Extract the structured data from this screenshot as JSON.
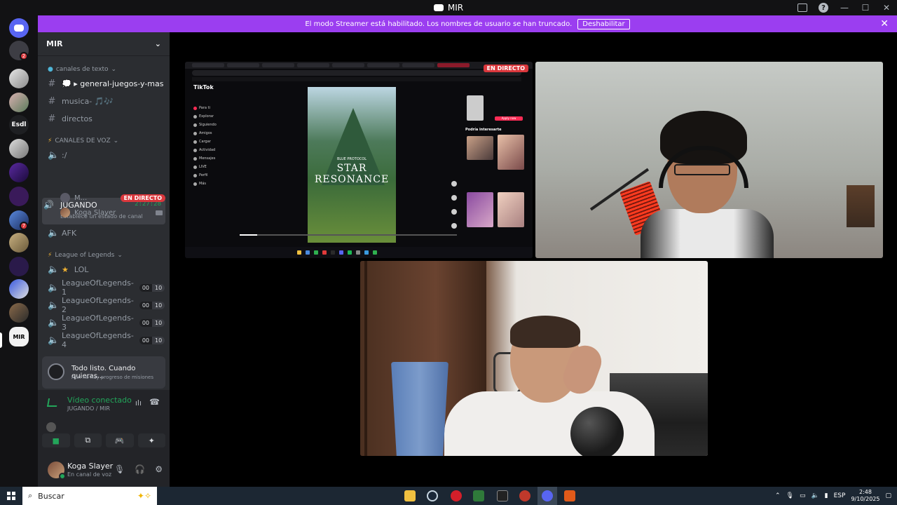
{
  "window": {
    "title": "MIR"
  },
  "streamer_banner": {
    "message": "El modo Streamer está habilitado. Los nombres de usuario se han truncado.",
    "disable_label": "Deshabilitar"
  },
  "servers": [
    {
      "name": "Esdl"
    }
  ],
  "guild": {
    "name": "MIR",
    "categories": {
      "text": "canales de texto",
      "voice": "CANALES DE VOZ",
      "lol": "League of Legends"
    },
    "text_channels": [
      {
        "name": "💭 ▸ general-juegos-y-mas"
      },
      {
        "name": "musica- 🎵🎶"
      },
      {
        "name": "directos"
      }
    ],
    "voice_channels": {
      "first": ":/",
      "jugando": {
        "name": "JUGANDO",
        "time": "2:27:28",
        "status": "Establece un estado de canal"
      },
      "users": [
        {
          "name": "M...",
          "badge": "EN DIRECTO"
        },
        {
          "name": "Koga Slayer"
        }
      ],
      "afk": "AFK",
      "lol": "LOL",
      "lol_channels": [
        {
          "name": "LeagueOfLegends-1",
          "count": "00",
          "limit": "10"
        },
        {
          "name": "LeagueOfLegends-2",
          "count": "00",
          "limit": "10"
        },
        {
          "name": "LeagueOfLegends-3",
          "count": "00",
          "limit": "10"
        },
        {
          "name": "LeagueOfLegends-4",
          "count": "00",
          "limit": "10"
        }
      ]
    }
  },
  "quest": {
    "title": "Todo listo. Cuando quieras...",
    "subtitle": "Aún no hay progreso de misiones"
  },
  "voice_status": {
    "title": "Vídeo conectado",
    "subtitle": "JUGANDO / MIR"
  },
  "user": {
    "name": "Koga Slayer",
    "status": "En canal de voz"
  },
  "stream": {
    "live_label": "EN DIRECTO",
    "tiktok": {
      "brand": "TikTok",
      "nav": [
        "Para ti",
        "Explorar",
        "Siguiendo",
        "Amigos",
        "Cargar",
        "Actividad",
        "Mensajes",
        "LIVE",
        "Perfil",
        "Más"
      ],
      "video_title": "STAR RESONANCE",
      "video_sub": "BLUE PROTOCOL",
      "right_title": "Podría interesarte",
      "apply": "Apply now",
      "progress": 0.08
    }
  },
  "taskbar": {
    "search_placeholder": "Buscar",
    "lang": "ESP",
    "time": "2:48",
    "date": "9/10/2025"
  },
  "colors": {
    "blurple": "#5865f2",
    "streamer": "#9b3ef0",
    "green": "#23a55a",
    "red": "#da373c"
  }
}
